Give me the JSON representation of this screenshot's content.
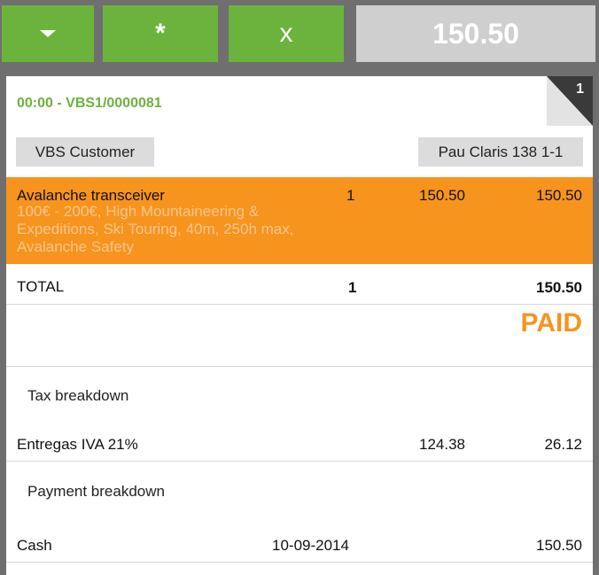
{
  "toolbar": {
    "menu_icon": "caret-down-icon",
    "star_label": "*",
    "close_label": "x",
    "total_display": "150.50"
  },
  "receipt": {
    "corner_number": "1",
    "order_id": "00:00 - VBS1/0000081",
    "customer": "VBS Customer",
    "table": "Pau Claris 138 1-1",
    "line": {
      "name": "Avalanche transceiver",
      "qty": "1",
      "price": "150.50",
      "amount": "150.50",
      "description": "100€ - 200€, High Mountaineering & Expeditions, Ski Touring, 40m, 250h max, Avalanche Safety"
    },
    "total_label": "TOTAL",
    "total_qty": "1",
    "total_amount": "150.50",
    "paid_label": "PAID",
    "tax_breakdown_label": "Tax breakdown",
    "tax": {
      "name": "Entregas IVA 21%",
      "base": "124.38",
      "amount": "26.12"
    },
    "payment_breakdown_label": "Payment breakdown",
    "payment": {
      "method": "Cash",
      "date": "10-09-2014",
      "amount": "150.50"
    }
  },
  "colors": {
    "green": "#6cb33e",
    "orange": "#f7941d",
    "gray_display": "#cfcfcf"
  }
}
